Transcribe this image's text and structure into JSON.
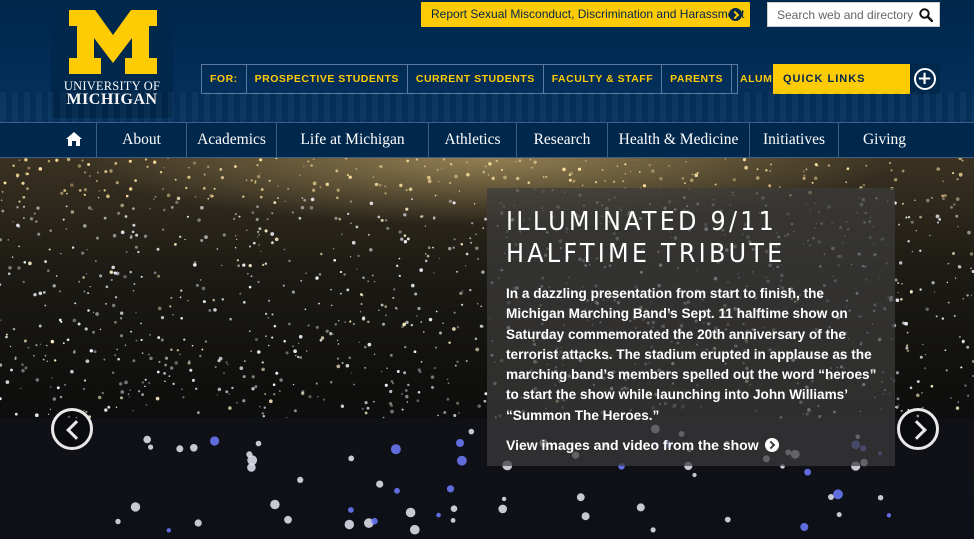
{
  "colors": {
    "maize": "#ffcb05",
    "blue": "#00274c"
  },
  "logo": {
    "line1": "UNIVERSITY OF",
    "line2": "MICHIGAN",
    "icon": "block-m-logo"
  },
  "utility": {
    "report_label": "Report Sexual Misconduct, Discrimination and Harassment",
    "report_icon": "arrow-circle-right-icon",
    "search_placeholder": "Search web and directory",
    "search_icon": "search-icon"
  },
  "audience": {
    "for_label": "FOR:",
    "items": [
      "PROSPECTIVE STUDENTS",
      "CURRENT STUDENTS",
      "FACULTY & STAFF",
      "PARENTS",
      "ALUMNI"
    ]
  },
  "quick_links": {
    "label": "QUICK LINKS",
    "icon": "plus-circle-icon"
  },
  "nav": {
    "home_icon": "home-icon",
    "items": [
      "About",
      "Academics",
      "Life at Michigan",
      "Athletics",
      "Research",
      "Health & Medicine",
      "Initiatives",
      "Giving"
    ]
  },
  "hero": {
    "title_line1": "ILLUMINATED 9/11",
    "title_line2": "HALFTIME TRIBUTE",
    "body": "In a dazzling presentation from start to finish, the Michigan Marching Band’s Sept. 11 halftime show on Saturday commemorated the 20th anniversary of the terrorist attacks. The stadium erupted in applause as the marching band’s members spelled out the word “heroes” to start the show while launching into John Williams’ “Summon The Heroes.”",
    "link_label": "View images and video from the show",
    "prev_icon": "chevron-left-circle-icon",
    "next_icon": "chevron-right-circle-icon"
  }
}
